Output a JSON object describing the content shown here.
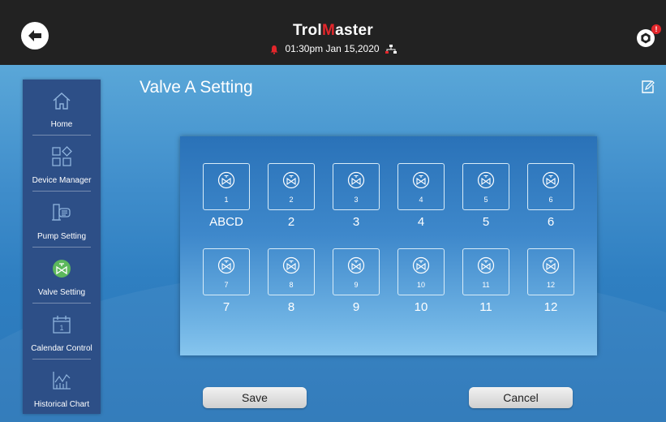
{
  "header": {
    "brand_part1": "Trol",
    "brand_highlight": "M",
    "brand_part2": "aster",
    "clock": "01:30pm  Jan 15,2020",
    "notification_count": "!",
    "alarm_color": "#e3262b"
  },
  "page": {
    "title": "Valve A Setting"
  },
  "sidebar": {
    "items": [
      {
        "label": "Home",
        "icon": "home-icon"
      },
      {
        "label": "Device Manager",
        "icon": "device-manager-icon"
      },
      {
        "label": "Pump Setting",
        "icon": "pump-icon"
      },
      {
        "label": "Valve Setting",
        "icon": "valve-icon",
        "active": true
      },
      {
        "label": "Calendar Control",
        "icon": "calendar-icon",
        "calendar_day": "1"
      },
      {
        "label": "Historical Chart",
        "icon": "chart-icon"
      }
    ]
  },
  "valves": [
    {
      "number": "1",
      "name": "ABCD"
    },
    {
      "number": "2",
      "name": "2"
    },
    {
      "number": "3",
      "name": "3"
    },
    {
      "number": "4",
      "name": "4"
    },
    {
      "number": "5",
      "name": "5"
    },
    {
      "number": "6",
      "name": "6"
    },
    {
      "number": "7",
      "name": "7"
    },
    {
      "number": "8",
      "name": "8"
    },
    {
      "number": "9",
      "name": "9"
    },
    {
      "number": "10",
      "name": "10"
    },
    {
      "number": "11",
      "name": "11"
    },
    {
      "number": "12",
      "name": "12"
    }
  ],
  "buttons": {
    "save": "Save",
    "cancel": "Cancel"
  }
}
